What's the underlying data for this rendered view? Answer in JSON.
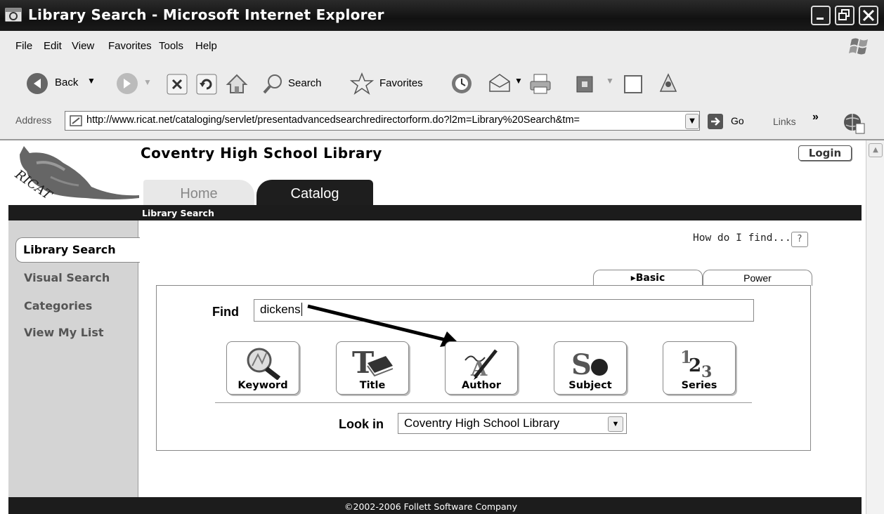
{
  "window": {
    "title": "Library Search - Microsoft Internet Explorer"
  },
  "menubar": {
    "items": [
      "File",
      "Edit",
      "View",
      "Favorites",
      "Tools",
      "Help"
    ]
  },
  "toolbar": {
    "back_label": "Back",
    "search_label": "Search",
    "favorites_label": "Favorites"
  },
  "addressbar": {
    "label": "Address",
    "url": "http://www.ricat.net/cataloging/servlet/presentadvancedsearchredirectorform.do?l2m=Library%20Search&tm=",
    "go_label": "Go",
    "links_label": "Links"
  },
  "site": {
    "school_name": "Coventry High School Library",
    "login_label": "Login",
    "tabs": [
      {
        "label": "Home",
        "active": false
      },
      {
        "label": "Catalog",
        "active": true
      }
    ],
    "breadcrumb": "Library Search",
    "nav": [
      {
        "label": "Library Search",
        "active": true
      },
      {
        "label": "Visual Search",
        "active": false
      },
      {
        "label": "Categories",
        "active": false
      },
      {
        "label": "View My List",
        "active": false
      }
    ],
    "how_do_i": "How do I find...",
    "help_label": "?",
    "search_tabs": [
      {
        "label": "▸Basic",
        "active": true
      },
      {
        "label": "Power",
        "active": false
      }
    ],
    "find_label": "Find",
    "find_value": "dickens",
    "search_buttons": [
      "Keyword",
      "Title",
      "Author",
      "Subject",
      "Series"
    ],
    "lookin_label": "Look in",
    "lookin_value": "Coventry High School Library",
    "footer": "©2002-2006  Follett Software Company"
  }
}
